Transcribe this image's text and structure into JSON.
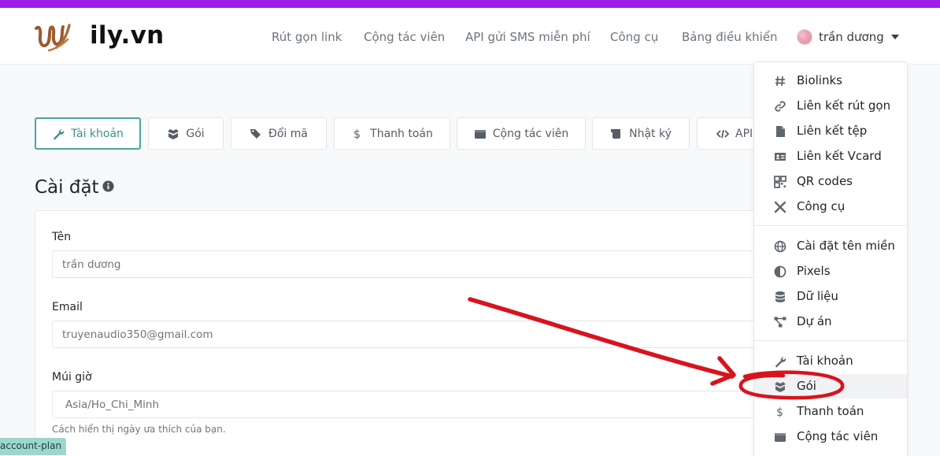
{
  "brand": {
    "name": "ily.vn"
  },
  "nav": {
    "links": [
      "Rút gọn link",
      "Cộng tác viên",
      "API gửi SMS miễn phí",
      "Công cụ",
      "Bảng điều khiển"
    ],
    "user_name": "trần dương"
  },
  "tabs": [
    {
      "label": "Tài khoản",
      "icon": "wrench-icon",
      "active": true
    },
    {
      "label": "Gói",
      "icon": "box-icon"
    },
    {
      "label": "Đổi mã",
      "icon": "tags-icon"
    },
    {
      "label": "Thanh toán",
      "icon": "dollar-icon"
    },
    {
      "label": "Cộng tác viên",
      "icon": "wallet-icon"
    },
    {
      "label": "Nhật ký",
      "icon": "scroll-icon"
    },
    {
      "label": "API",
      "icon": "code-icon"
    }
  ],
  "page": {
    "title": "Cài đặt"
  },
  "form": {
    "name_label": "Tên",
    "name_value": "trần dương",
    "email_label": "Email",
    "email_value": "truyenaudio350@gmail.com",
    "timezone_label": "Múi giờ",
    "timezone_value": "Asia/Ho_Chi_Minh",
    "timezone_help": "Cách hiển thị ngày ưa thích của bạn."
  },
  "status_badge": "account-plan",
  "dropdown": {
    "items": [
      {
        "label": "Biolinks",
        "icon": "hash-icon"
      },
      {
        "label": "Liên kết rút gọn",
        "icon": "link-icon"
      },
      {
        "label": "Liên kết tệp",
        "icon": "file-icon"
      },
      {
        "label": "Liên kết Vcard",
        "icon": "id-card-icon"
      },
      {
        "label": "QR codes",
        "icon": "qrcode-icon"
      },
      {
        "label": "Công cụ",
        "icon": "tools-icon"
      },
      {
        "label": "Cài đặt tên miền",
        "icon": "globe-icon"
      },
      {
        "label": "Pixels",
        "icon": "adjust-icon"
      },
      {
        "label": "Dữ liệu",
        "icon": "database-icon"
      },
      {
        "label": "Dự án",
        "icon": "project-diagram-icon"
      },
      {
        "label": "Tài khoản",
        "icon": "wrench-icon"
      },
      {
        "label": "Gói",
        "icon": "box-icon",
        "highlighted": true
      },
      {
        "label": "Thanh toán",
        "icon": "dollar-icon"
      },
      {
        "label": "Cộng tác viên",
        "icon": "wallet-icon"
      }
    ]
  },
  "colors": {
    "top_accent": "#a01fe6",
    "active_tab": "#49a69b",
    "annotation": "#d8131c",
    "badge": "#9ed6cf"
  }
}
